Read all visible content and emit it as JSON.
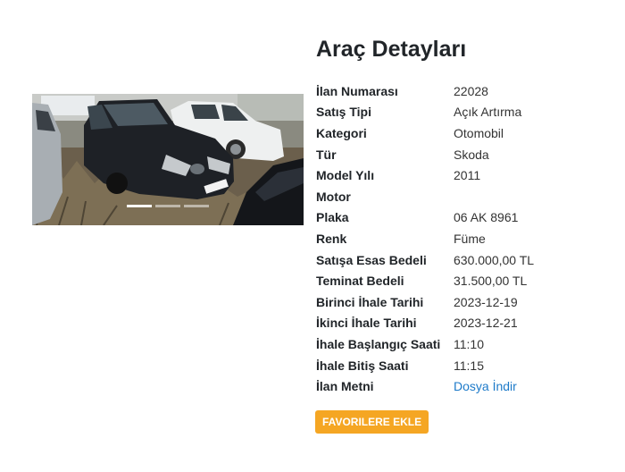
{
  "page": {
    "title": "Araç Detayları"
  },
  "gallery": {
    "image_alt": "Skoda vehicle photo",
    "slide_count": 3,
    "active_slide": 1
  },
  "details": [
    {
      "label": "İlan Numarası",
      "value": "22028"
    },
    {
      "label": "Satış Tipi",
      "value": "Açık Artırma"
    },
    {
      "label": "Kategori",
      "value": "Otomobil"
    },
    {
      "label": "Tür",
      "value": "Skoda"
    },
    {
      "label": "Model Yılı",
      "value": "2011"
    },
    {
      "label": "Motor",
      "value": ""
    },
    {
      "label": "Plaka",
      "value": "06 AK 8961"
    },
    {
      "label": "Renk",
      "value": "Füme"
    },
    {
      "label": "Satışa Esas Bedeli",
      "value": "630.000,00 TL"
    },
    {
      "label": "Teminat Bedeli",
      "value": "31.500,00 TL"
    },
    {
      "label": "Birinci İhale Tarihi",
      "value": "2023-12-19"
    },
    {
      "label": "İkinci İhale Tarihi",
      "value": "2023-12-21"
    },
    {
      "label": "İhale Başlangıç Saati",
      "value": "11:10"
    },
    {
      "label": "İhale Bitiş Saati",
      "value": "11:15"
    },
    {
      "label": "İlan Metni",
      "value": "Dosya İndir",
      "link": true
    }
  ],
  "actions": {
    "favorite_label": "FAVORILERE EKLE"
  },
  "colors": {
    "accent": "#f5a623",
    "link": "#1d7ac9"
  }
}
